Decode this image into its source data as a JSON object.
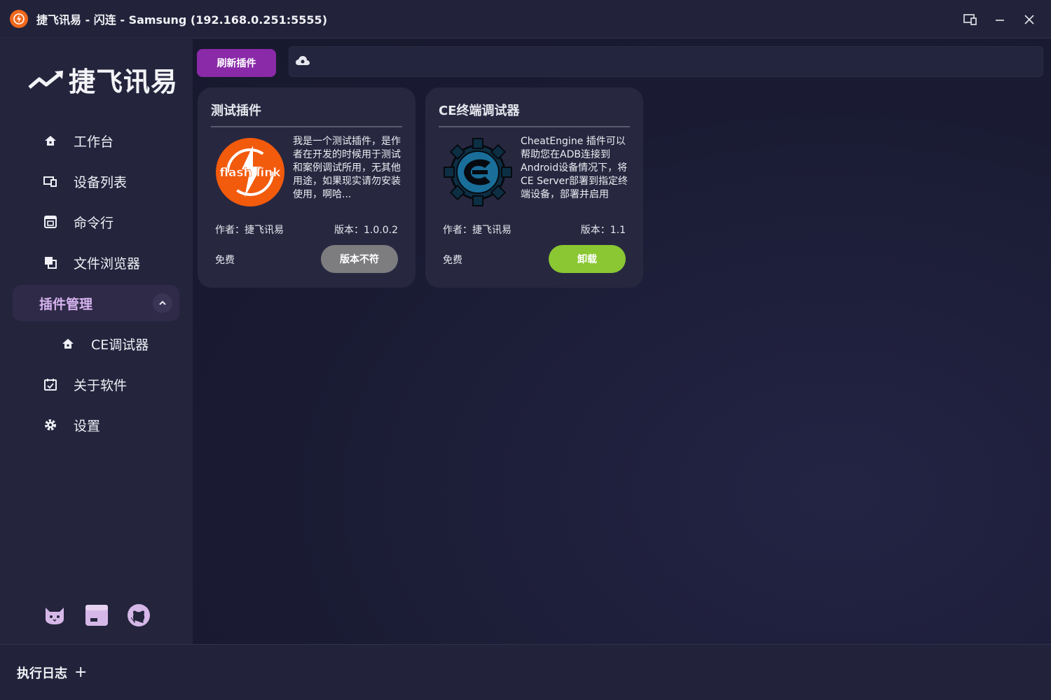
{
  "window": {
    "title": "捷飞讯易 - 闪连 - Samsung (192.168.0.251:5555)",
    "controls": [
      "restore-icon",
      "minimize-icon",
      "close-icon"
    ]
  },
  "sidebar": {
    "logo_text": "捷飞讯易",
    "items": [
      {
        "label": "工作台",
        "icon": "home-icon"
      },
      {
        "label": "设备列表",
        "icon": "devices-icon"
      },
      {
        "label": "命令行",
        "icon": "terminal-icon"
      },
      {
        "label": "文件浏览器",
        "icon": "files-icon"
      }
    ],
    "group": {
      "label": "插件管理",
      "expanded": true
    },
    "sub_items": [
      {
        "label": "CE调试器",
        "icon": "home-icon"
      }
    ],
    "bottom_items": [
      {
        "label": "关于软件",
        "icon": "calendar-check-icon"
      },
      {
        "label": "设置",
        "icon": "gear-icon"
      }
    ],
    "social": [
      "cat-icon",
      "storefront-icon",
      "github-icon"
    ]
  },
  "toolbar": {
    "refresh_label": "刷新插件"
  },
  "plugins": [
    {
      "title": "测试插件",
      "logo_text": "flash link",
      "description": "我是一个测试插件，是作者在开发的时候用于测试和案例调试所用，无其他用途，如果现实请勿安装使用，啊哈...",
      "author": "作者：捷飞讯易",
      "version": "版本：1.0.0.2",
      "price": "免费",
      "action_label": "版本不符",
      "action_color": "#7d7d80"
    },
    {
      "title": "CE终端调试器",
      "description": "CheatEngine 插件可以帮助您在ADB连接到Android设备情况下，将CE Server部署到指定终端设备，部署并启用",
      "author": "作者：捷飞讯易",
      "version": "版本：1.1",
      "price": "免费",
      "action_label": "卸载",
      "action_color": "#8ac732"
    }
  ],
  "footer": {
    "log_label": "执行日志",
    "plus": "+"
  },
  "colors": {
    "accent": "#8a2aa8",
    "group_label": "#d7b4ef",
    "brand_orange": "#f0681c"
  }
}
